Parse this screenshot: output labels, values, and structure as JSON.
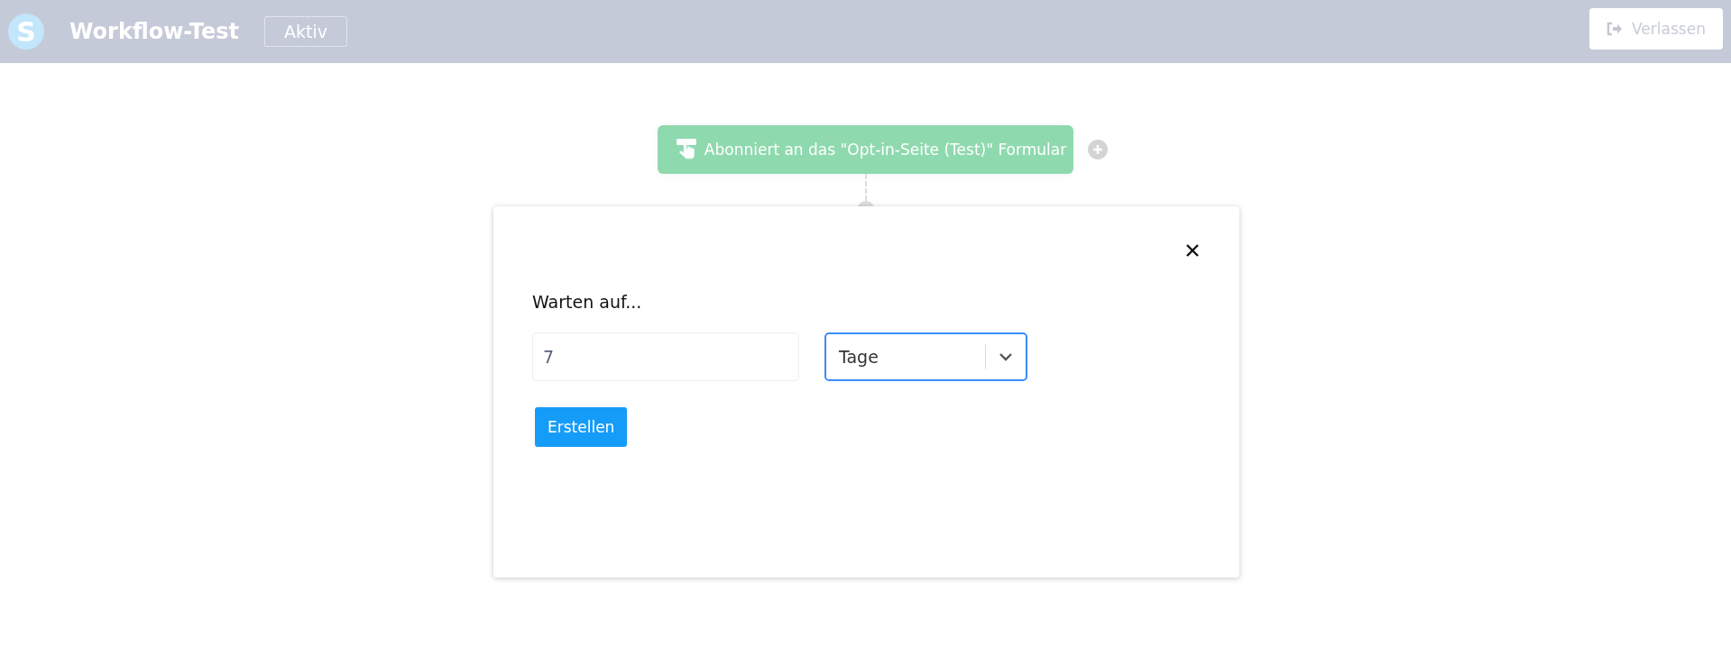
{
  "header": {
    "logo_letter": "S",
    "title": "Workflow-Test",
    "status": "Aktiv",
    "leave_button": "Verlassen"
  },
  "workflow": {
    "trigger": {
      "label": "Abonniert an das \"Opt-in-Seite (Test)\" Formular"
    }
  },
  "dialog": {
    "heading": "Warten auf...",
    "amount": {
      "value": "7"
    },
    "unit": {
      "value": "Tage"
    },
    "submit": "Erstellen"
  }
}
